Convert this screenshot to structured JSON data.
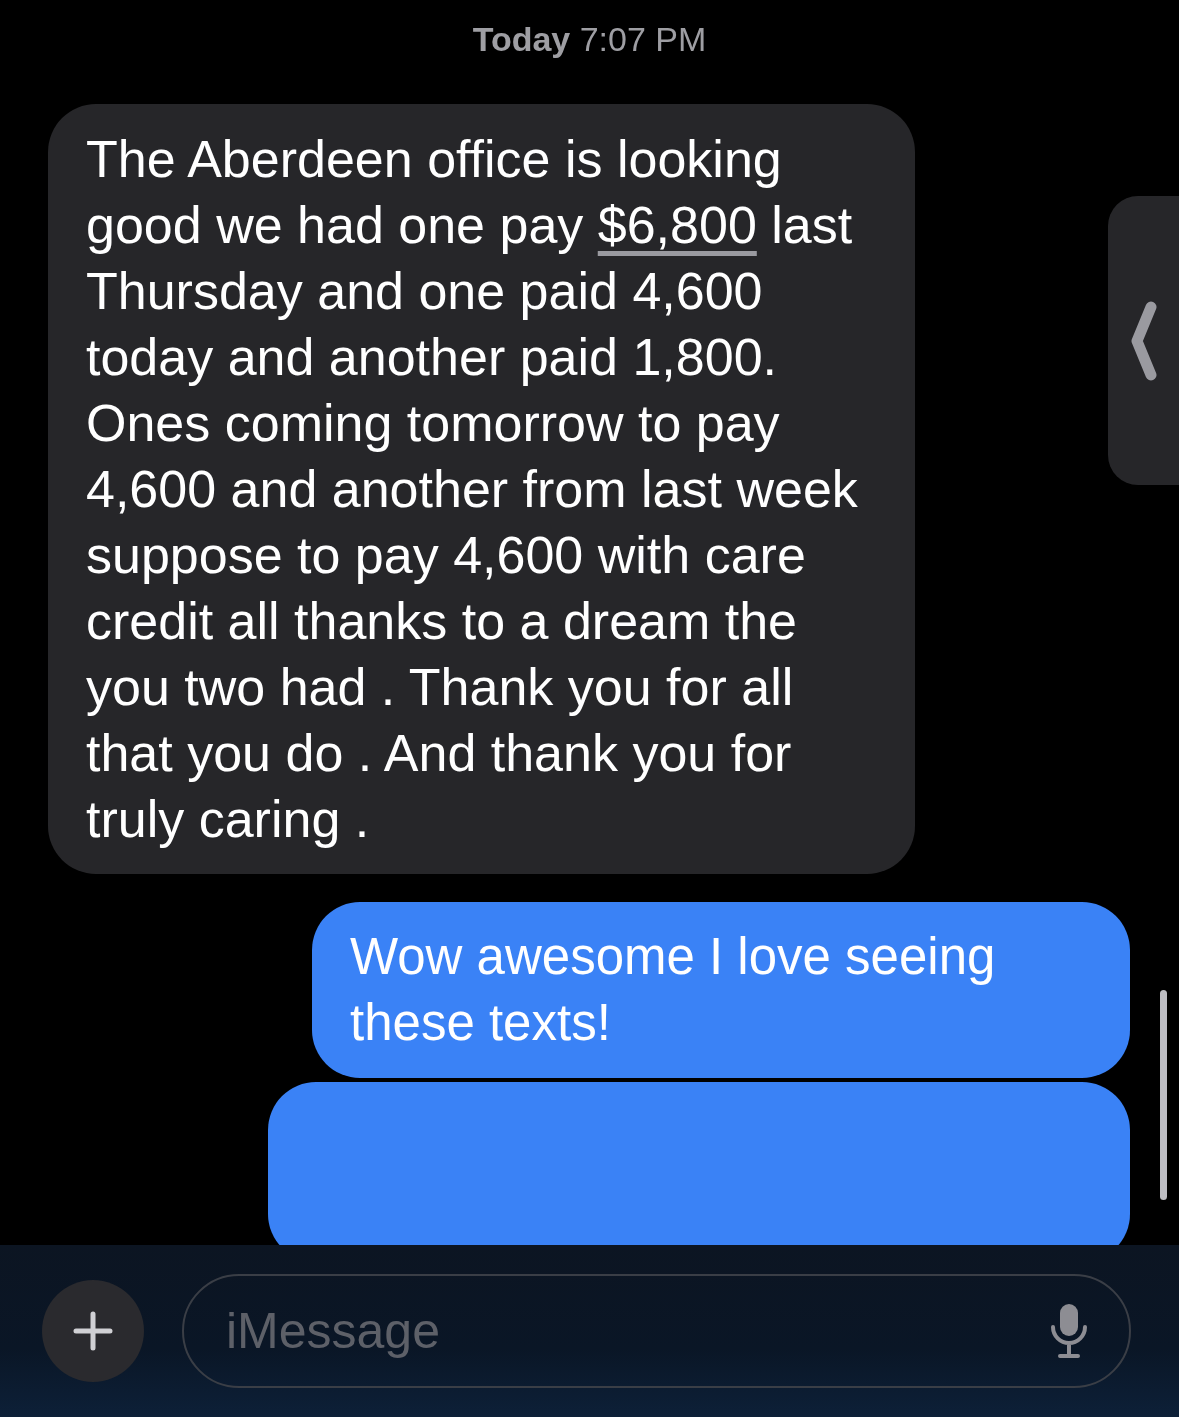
{
  "timestamp": "**Today** 7:07 PM",
  "messages": [
    {
      "kind": "incoming",
      "before": "The Aberdeen office is looking good we had one pay",
      "link": "$6,800",
      "after": "last Thursday and one paid 4,600 today and another paid 1,800. Ones coming tomorrow to pay 4,600 and another from last week suppose to pay 4,600 with care credit all thanks to a dream the you two had . Thank you for all that you do . And thank you for truly caring ."
    },
    {
      "kind": "outgoing",
      "text": "Wow awesome I love seeing these texts!"
    },
    {
      "kind": "outgoing"
    }
  ],
  "composer": {
    "placeholder": "iMessage"
  }
}
